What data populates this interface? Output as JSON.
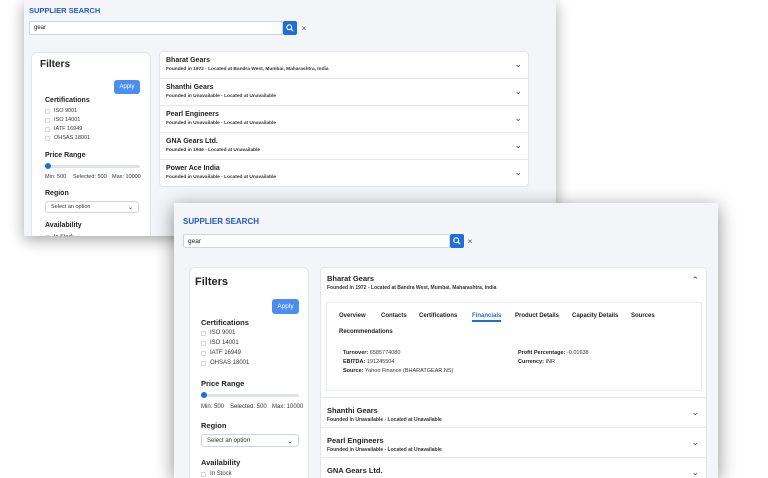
{
  "app": {
    "title": "SUPPLIER SEARCH"
  },
  "search": {
    "value": "gear",
    "clear": "×"
  },
  "filters": {
    "title": "Filters",
    "apply_label": "Apply",
    "certifications_label": "Certifications",
    "certifications": [
      "ISO 9001",
      "ISO 14001",
      "IATF 16949",
      "OHSAS 18001"
    ],
    "price_range_label": "Price Range",
    "price": {
      "min_text": "Min: 500",
      "selected_text": "Selected: 500",
      "max_text": "Max: 10000",
      "position": 0.0
    },
    "region_label": "Region",
    "region_placeholder": "Select an option",
    "availability_label": "Availability",
    "availability_first": "In Stock"
  },
  "suppliers": [
    {
      "name": "Bharat Gears",
      "details": "Founded in 1972 - Located at Bandra West, Mumbai, Maharashtra, India"
    },
    {
      "name": "Shanthi Gears",
      "details": "Founded in Unavailable - Located at Unavailable"
    },
    {
      "name": "Pearl Engineers",
      "details": "Founded in Unavailable - Located at Unavailable"
    },
    {
      "name": "GNA Gears Ltd.",
      "details": "Founded in 1946 - Located at Unavailable"
    },
    {
      "name": "Power Ace India",
      "details": "Founded in Unavailable - Located at Unavailable"
    }
  ],
  "detail_tabs": [
    "Overview",
    "Contacts",
    "Certifications",
    "Financials",
    "Product Details",
    "Capacity Details",
    "Sources",
    "Recommendations"
  ],
  "active_tab": "Financials",
  "financials": {
    "turnover_label": "Turnover:",
    "turnover": "6585774080",
    "ebitda_label": "EBITDA:",
    "ebitda": "191245504",
    "source_label": "Source:",
    "source": "Yahoo Finance (BHARATGEAR.NS)",
    "profit_label": "Profit Percentage:",
    "profit": "-0.01638",
    "currency_label": "Currency:",
    "currency": "INR"
  },
  "colors": {
    "accent": "#1f6fd6",
    "title": "#2457c5",
    "apply": "#4a8ef0"
  }
}
